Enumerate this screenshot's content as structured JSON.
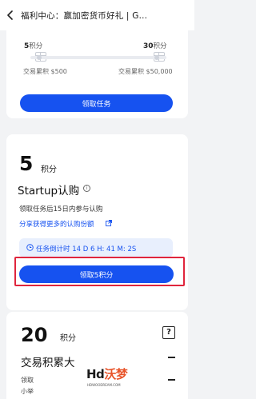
{
  "header": {
    "title": "福利中心：赢加密货币好礼 | G…"
  },
  "rewards_tiers": {
    "tiers": [
      {
        "points": "5",
        "unit": "积分",
        "condition": "交易累积 $500"
      },
      {
        "points": "30",
        "unit": "积分",
        "condition": "交易累积 $50,000"
      }
    ],
    "button_label": "领取任务"
  },
  "startup_task": {
    "points": "5",
    "points_unit": "积分",
    "title": "Startup认购",
    "info_icon_glyph": "i",
    "description": "领取任务后15日内参与认购",
    "share_link": "分享获得更多的认购份额",
    "countdown": "任务倒计时 14 D 6 H: 41 M: 2S",
    "claim_button": "领取5积分"
  },
  "next_task": {
    "points": "20",
    "points_unit": "积分",
    "help_glyph": "?",
    "title": "交易积累大",
    "sub1": "领取",
    "sub2": "小举"
  },
  "watermark": {
    "main_prefix": "Hd",
    "main_accent": "沃梦",
    "sub": "HDWOODREAM.COM"
  },
  "colors": {
    "primary": "#1652f0",
    "highlight": "#e0253d",
    "countdown_bg": "#e8effd"
  }
}
